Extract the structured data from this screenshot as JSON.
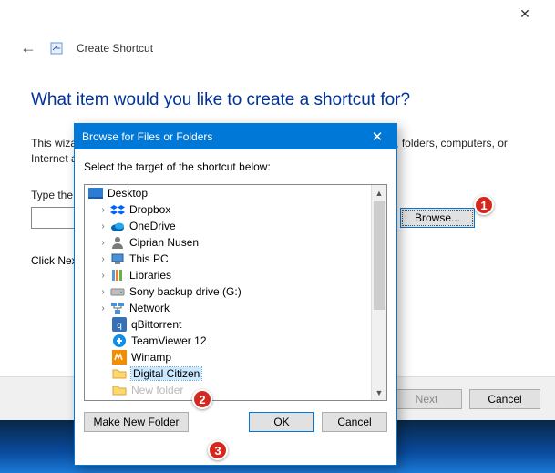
{
  "main": {
    "title": "Create Shortcut",
    "question": "What item would you like to create a shortcut for?",
    "description": "This wizard helps you to create shortcuts to local or network programs, files, folders, computers, or Internet addresses.",
    "type_label": "Type the location of the item:",
    "location_value": "",
    "browse_label": "Browse...",
    "click_next": "Click Next to continue.",
    "next_label": "Next",
    "cancel_label": "Cancel"
  },
  "dialog": {
    "title": "Browse for Files or Folders",
    "instruction": "Select the target of the shortcut below:",
    "make_folder_label": "Make New Folder",
    "ok_label": "OK",
    "cancel_label": "Cancel",
    "tree": {
      "root": "Desktop",
      "items": [
        {
          "label": "Dropbox",
          "icon": "dropbox",
          "expandable": true
        },
        {
          "label": "OneDrive",
          "icon": "onedrive",
          "expandable": true
        },
        {
          "label": "Ciprian Nusen",
          "icon": "user",
          "expandable": true
        },
        {
          "label": "This PC",
          "icon": "pc",
          "expandable": true
        },
        {
          "label": "Libraries",
          "icon": "libraries",
          "expandable": true
        },
        {
          "label": "Sony backup drive (G:)",
          "icon": "drive",
          "expandable": true
        },
        {
          "label": "Network",
          "icon": "network",
          "expandable": true
        },
        {
          "label": "qBittorrent",
          "icon": "app-qb",
          "expandable": false
        },
        {
          "label": "TeamViewer 12",
          "icon": "app-tv",
          "expandable": false
        },
        {
          "label": "Winamp",
          "icon": "app-wa",
          "expandable": false
        },
        {
          "label": "Digital Citizen",
          "icon": "folder",
          "expandable": false,
          "selected": true
        },
        {
          "label": "New folder",
          "icon": "folder",
          "expandable": false,
          "cut": true
        }
      ]
    }
  },
  "annotations": {
    "b1": "1",
    "b2": "2",
    "b3": "3"
  }
}
